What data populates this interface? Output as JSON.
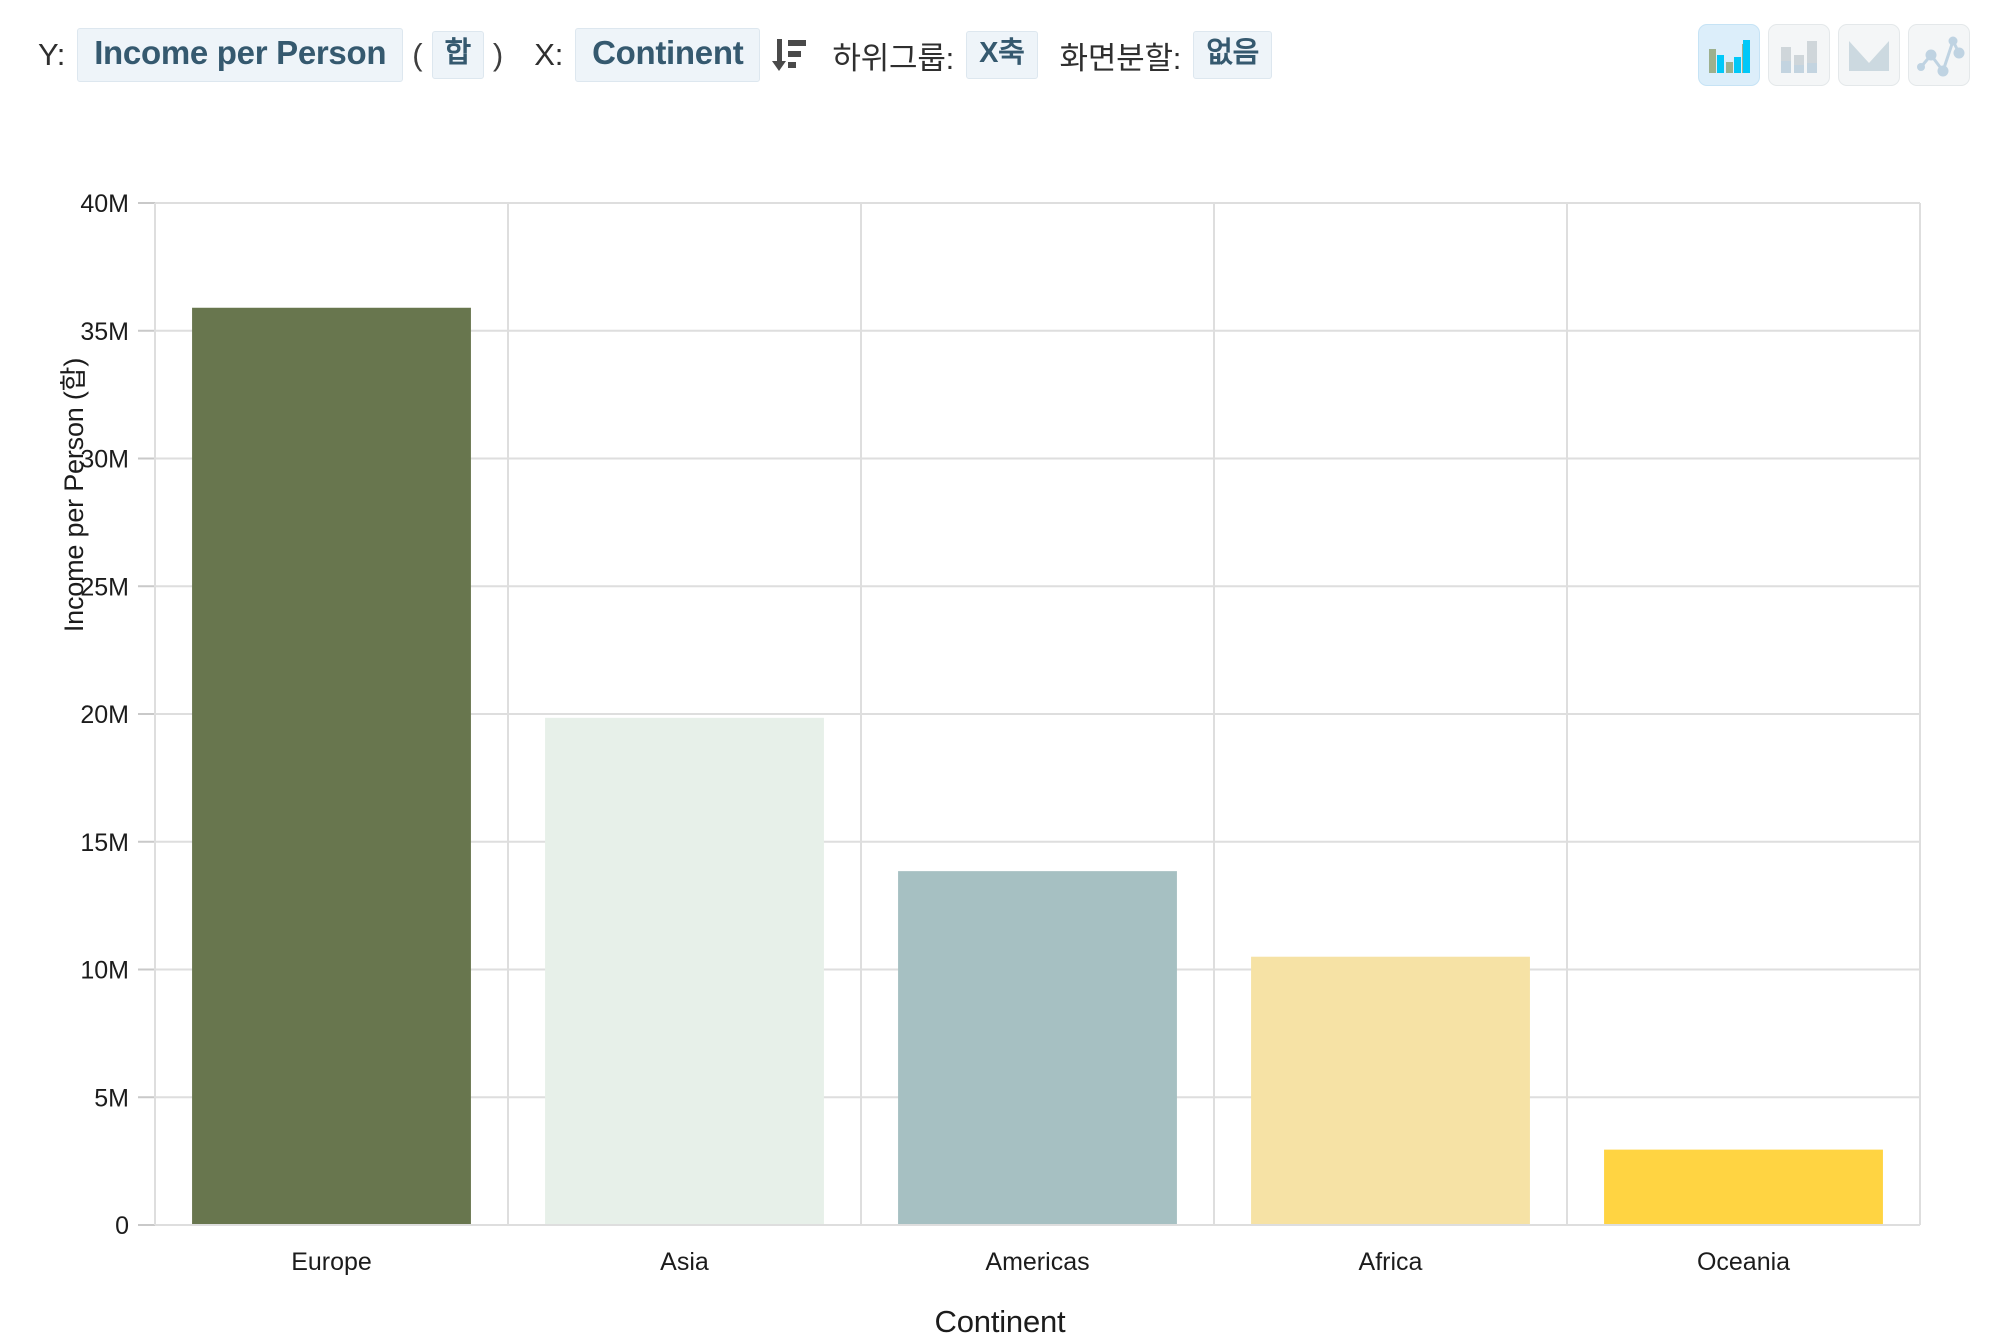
{
  "control_bar": {
    "y_label": "Y:",
    "y_field": "Income per Person",
    "paren_open": "(",
    "aggregation": "합",
    "paren_close": ")",
    "x_label": "X:",
    "x_field": "Continent",
    "sort_icon": "sort-descending-icon",
    "subgroup_label": "하위그룹:",
    "subgroup_value": "X축",
    "split_label": "화면분할:",
    "split_value": "없음",
    "chart_type_buttons": [
      {
        "name": "grouped-bar-chart",
        "active": true
      },
      {
        "name": "stacked-bar-chart",
        "active": false
      },
      {
        "name": "area-chart",
        "active": false
      },
      {
        "name": "line-chart",
        "active": false
      }
    ]
  },
  "chart_data": {
    "type": "bar",
    "title": "",
    "xlabel": "Continent",
    "ylabel": "Income per Person (합)",
    "categories": [
      "Europe",
      "Asia",
      "Americas",
      "Africa",
      "Oceania"
    ],
    "values": [
      35900000,
      19850000,
      13850000,
      10500000,
      2950000
    ],
    "colors": [
      "#68764E",
      "#E7F0E9",
      "#A6C0C2",
      "#F6E2A5",
      "#FFD442"
    ],
    "ylim": [
      0,
      40000000
    ],
    "ytick_values": [
      0,
      5000000,
      10000000,
      15000000,
      20000000,
      25000000,
      30000000,
      35000000,
      40000000
    ],
    "ytick_labels": [
      "0",
      "5M",
      "10M",
      "15M",
      "20M",
      "25M",
      "30M",
      "35M",
      "40M"
    ],
    "grid": true,
    "legend": "none"
  }
}
